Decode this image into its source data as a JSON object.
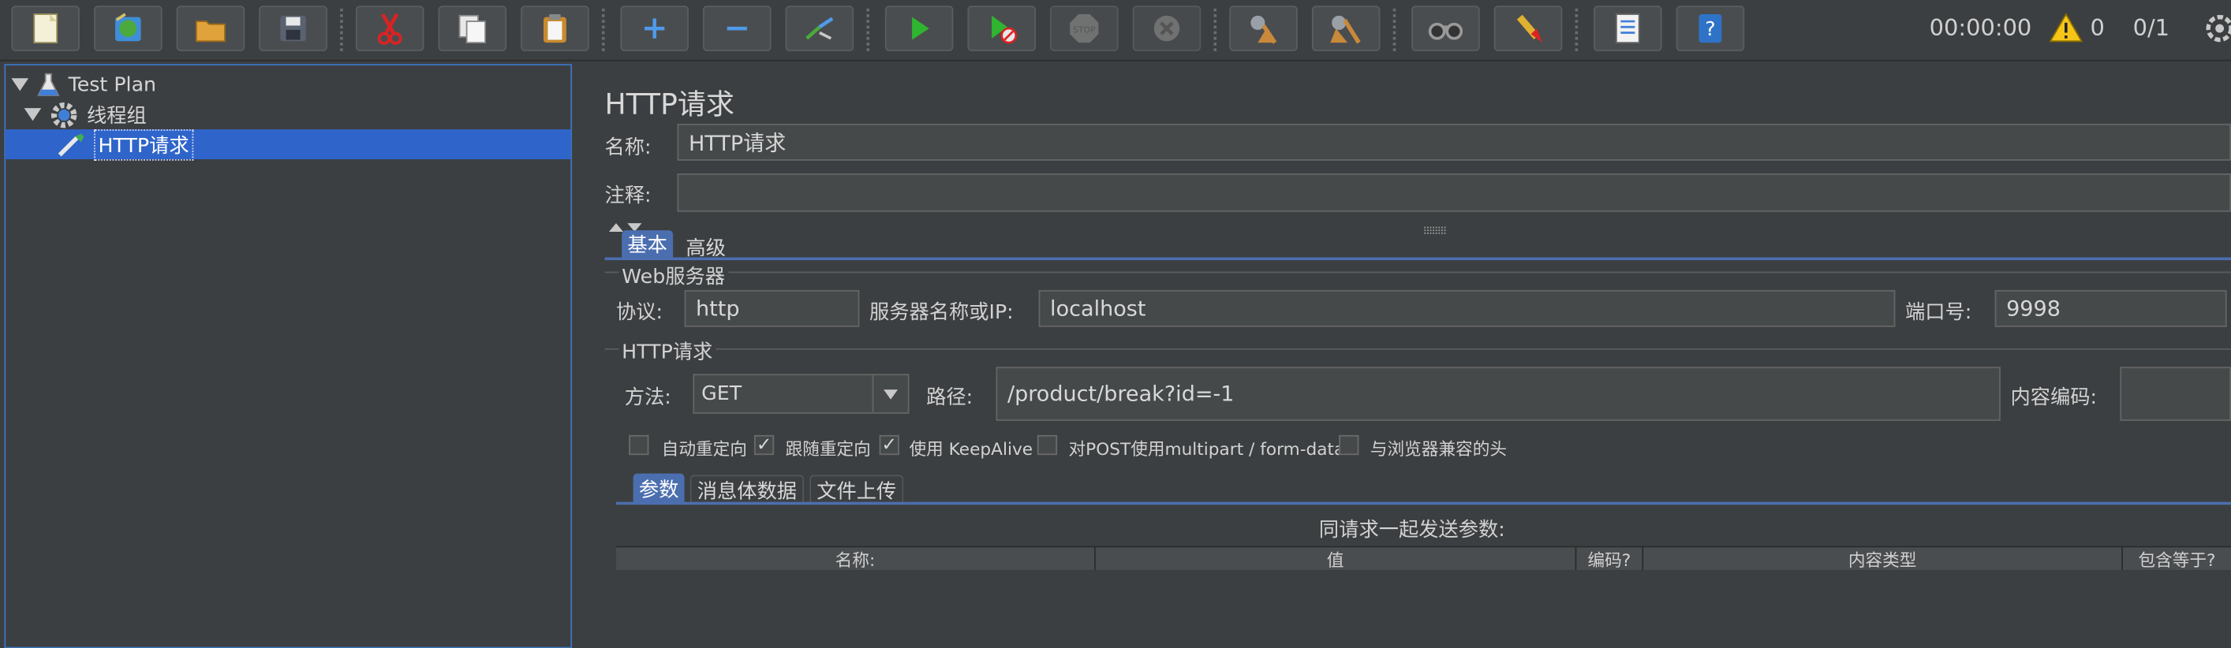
{
  "toolbar": {
    "buttons": [
      {
        "name": "new-icon"
      },
      {
        "name": "templates-icon"
      },
      {
        "name": "open-icon"
      },
      {
        "name": "save-icon"
      },
      {
        "name": "cut-icon"
      },
      {
        "name": "copy-icon"
      },
      {
        "name": "paste-icon"
      },
      {
        "name": "expand-icon"
      },
      {
        "name": "collapse-icon"
      },
      {
        "name": "toggle-icon"
      },
      {
        "name": "start-icon"
      },
      {
        "name": "start-no-pause-icon"
      },
      {
        "name": "stop-icon"
      },
      {
        "name": "shutdown-icon"
      },
      {
        "name": "clear-icon"
      },
      {
        "name": "clear-all-icon"
      },
      {
        "name": "search-icon"
      },
      {
        "name": "reset-search-icon"
      },
      {
        "name": "function-helper-icon"
      },
      {
        "name": "help-icon"
      }
    ],
    "elapsed_time": "00:00:00",
    "warning_count": "0",
    "threads": "0/1"
  },
  "tree": {
    "items": [
      {
        "label": "Test Plan",
        "icon": "flask-icon"
      },
      {
        "label": "线程组",
        "icon": "gear-icon"
      },
      {
        "label": "HTTP请求",
        "icon": "pipette-icon"
      }
    ]
  },
  "panel": {
    "title": "HTTP请求",
    "name_label": "名称:",
    "name_value": "HTTP请求",
    "comment_label": "注释:",
    "comment_value": "",
    "tabs": [
      "基本",
      "高级"
    ],
    "web_server": {
      "legend": "Web服务器",
      "protocol_label": "协议:",
      "protocol_value": "http",
      "server_label": "服务器名称或IP:",
      "server_value": "localhost",
      "port_label": "端口号:",
      "port_value": "9998"
    },
    "http_request": {
      "legend": "HTTP请求",
      "method_label": "方法:",
      "method_value": "GET",
      "path_label": "路径:",
      "path_value": "/product/break?id=-1",
      "encoding_label": "内容编码:",
      "encoding_value": ""
    },
    "options": [
      {
        "label": "自动重定向",
        "checked": false
      },
      {
        "label": "跟随重定向",
        "checked": true
      },
      {
        "label": "使用 KeepAlive",
        "checked": true
      },
      {
        "label": "对POST使用multipart / form-data",
        "checked": false
      },
      {
        "label": "与浏览器兼容的头",
        "checked": false
      }
    ],
    "param_tabs": [
      "参数",
      "消息体数据",
      "文件上传"
    ],
    "params_caption": "同请求一起发送参数:",
    "columns": [
      "名称:",
      "值",
      "编码?",
      "内容类型",
      "包含等于?"
    ]
  },
  "colors": {
    "accent": "#4b6eaf",
    "selection": "#2f65ca",
    "background": "#3c3f41"
  }
}
